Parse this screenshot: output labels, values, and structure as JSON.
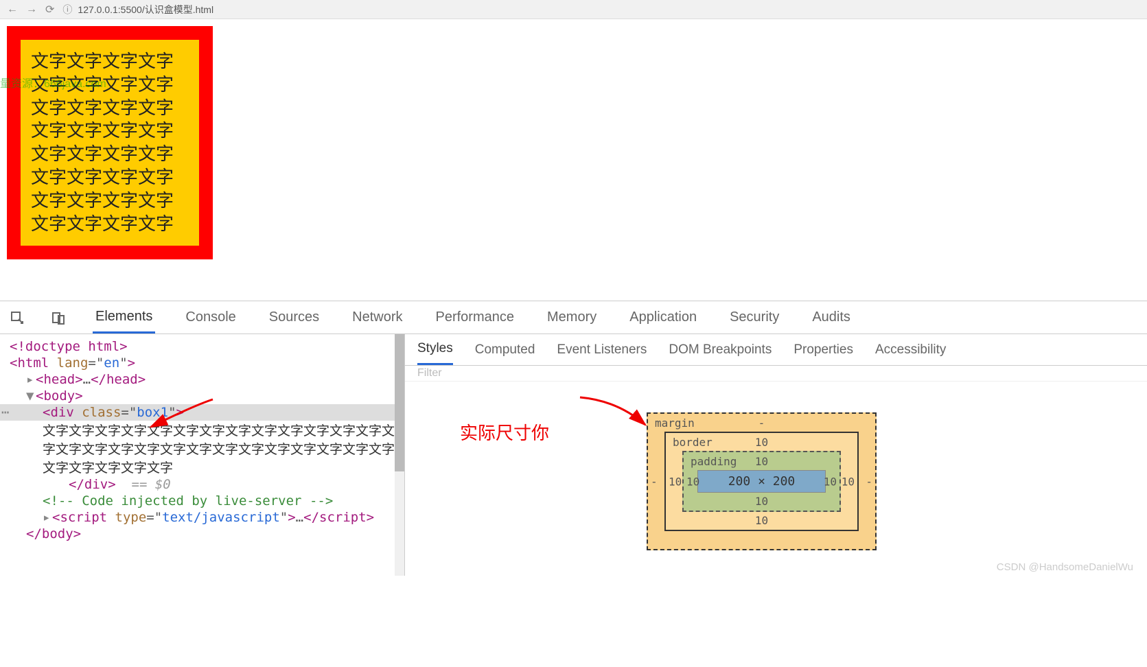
{
  "browser": {
    "url": "127.0.0.1:5500/认识盒模型.html"
  },
  "page": {
    "watermark": "量资源：666java.com",
    "box_text": "文字文字文字文字文字文字文字文字文字文字文字文字文字文字文字文字文字文字文字文字文字文字文字文字文字文字文字文字文字文字文字文字"
  },
  "devtools": {
    "tabs": [
      "Elements",
      "Console",
      "Sources",
      "Network",
      "Performance",
      "Memory",
      "Application",
      "Security",
      "Audits"
    ],
    "active_tab": "Elements",
    "styles_tabs": [
      "Styles",
      "Computed",
      "Event Listeners",
      "DOM Breakpoints",
      "Properties",
      "Accessibility"
    ],
    "styles_active": "Styles",
    "filter_placeholder": "Filter"
  },
  "elements": {
    "doctype": "<!doctype html>",
    "html_open": "html",
    "html_lang": "en",
    "head": "head",
    "body": "body",
    "div_class": "box1",
    "div_text": "文字文字文字文字文字文字文字文字文字文字文字文字文字文字文字文字文字文字文字文字文字文字文字文字文字文字文字文字文字文字文字文字",
    "eq_text": "== $0",
    "comment": " Code injected by live-server ",
    "script_type": "text/javascript"
  },
  "annotation": {
    "text": "实际尺寸你"
  },
  "box_model": {
    "margin": {
      "label": "margin",
      "top": "-",
      "left": "-",
      "right": "-",
      "bottom": ""
    },
    "border": {
      "label": "border",
      "top": "10",
      "left": "10",
      "right": "10",
      "bottom": "10"
    },
    "padding": {
      "label": "padding",
      "top": "10",
      "left": "10",
      "right": "10",
      "bottom": "10"
    },
    "content": "200 × 200"
  },
  "csdn": "CSDN @HandsomeDanielWu"
}
